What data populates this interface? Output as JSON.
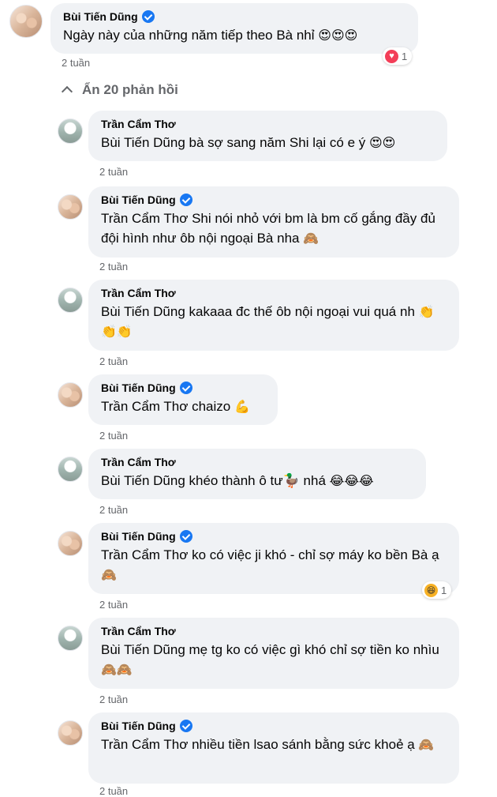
{
  "top_comment": {
    "author": "Bùi Tiến Dũng",
    "verified": true,
    "text": "Ngày này của những năm tiếp theo Bà nhỉ",
    "emoji": "😍😍😍",
    "time": "2 tuần",
    "reaction": {
      "icon": "love-icon",
      "count": "1"
    }
  },
  "hide_replies": {
    "label": "Ẩn 20 phản hồi"
  },
  "replies": [
    {
      "author": "Trần Cẩm Thơ",
      "verified": false,
      "text": "Bùi Tiến Dũng bà sợ sang năm Shi lại có e ý",
      "emoji": "😍😍",
      "time": "2 tuần"
    },
    {
      "author": "Bùi Tiến Dũng",
      "verified": true,
      "text": "Trần Cẩm Thơ Shi nói nhỏ với bm là bm cố gắng đầy đủ đội hình như ôb nội ngoại Bà nha",
      "emoji": "🙈",
      "time": "2 tuần"
    },
    {
      "author": "Trần Cẩm Thơ",
      "verified": false,
      "text": "Bùi Tiến Dũng kakaaa đc thế ôb nội ngoại vui quá nh",
      "emoji": "👏👏👏",
      "time": "2 tuần"
    },
    {
      "author": "Bùi Tiến Dũng",
      "verified": true,
      "text": "Trần Cẩm Thơ chaizo",
      "emoji": "💪",
      "time": "2 tuần"
    },
    {
      "author": "Trần Cẩm Thơ",
      "verified": false,
      "text": "Bùi Tiến Dũng khéo thành ô tư🦆 nhá",
      "emoji": "😂😂😂",
      "time": "2 tuần"
    },
    {
      "author": "Bùi Tiến Dũng",
      "verified": true,
      "text": "Trần Cẩm Thơ ko có việc ji khó - chỉ sợ máy ko bền Bà ạ",
      "emoji": "🙈",
      "time": "2 tuần",
      "reaction": {
        "icon": "haha-icon",
        "count": "1"
      }
    },
    {
      "author": "Trần Cẩm Thơ",
      "verified": false,
      "text": "Bùi Tiến Dũng mẹ tg ko có việc gì khó chỉ sợ tiền ko nhìu",
      "emoji": "🙈🙈",
      "time": "2 tuần"
    },
    {
      "author": "Bùi Tiến Dũng",
      "verified": true,
      "text": "Trần Cẩm Thơ nhiều tiền lsao sánh bằng sức khoẻ ạ",
      "emoji": "🙈",
      "time": "2 tuần"
    }
  ]
}
